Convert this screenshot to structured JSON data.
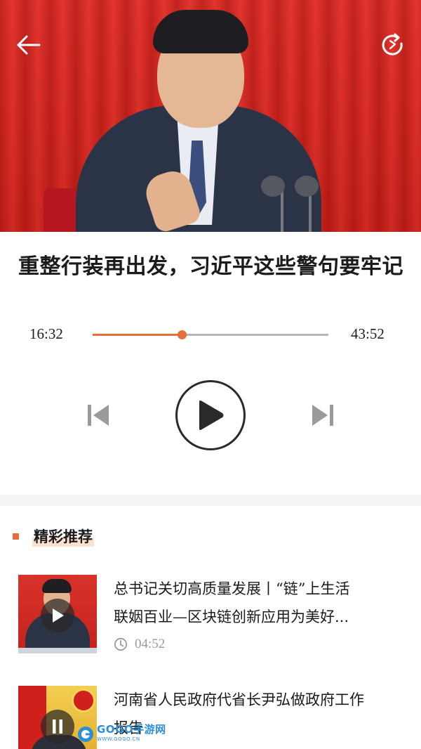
{
  "header": {
    "back_icon": "arrow-left-icon",
    "refresh_icon": "refresh-icon"
  },
  "article": {
    "title": "重整行装再出发，习近平这些警句要牢记"
  },
  "player": {
    "current_time": "16:32",
    "total_time": "43:52",
    "progress": 0.377,
    "accent_color": "#e36f3b",
    "controls": [
      "previous-icon",
      "play-icon",
      "next-icon"
    ]
  },
  "recommend": {
    "section_title": "精彩推荐",
    "items": [
      {
        "title_line1": "总书记关切高质量发展丨“链”上生活",
        "title_line2": "联姻百业—区块链创新应用为美好...",
        "duration": "04:52",
        "overlay_icon": "play-icon"
      },
      {
        "title_line1": "河南省人民政府代省长尹弘做政府工作",
        "title_line2": "报告",
        "overlay_icon": "pause-icon"
      }
    ]
  },
  "watermark": {
    "brand": "GOGO手游网",
    "url": "WWW.GOGO.CN"
  }
}
